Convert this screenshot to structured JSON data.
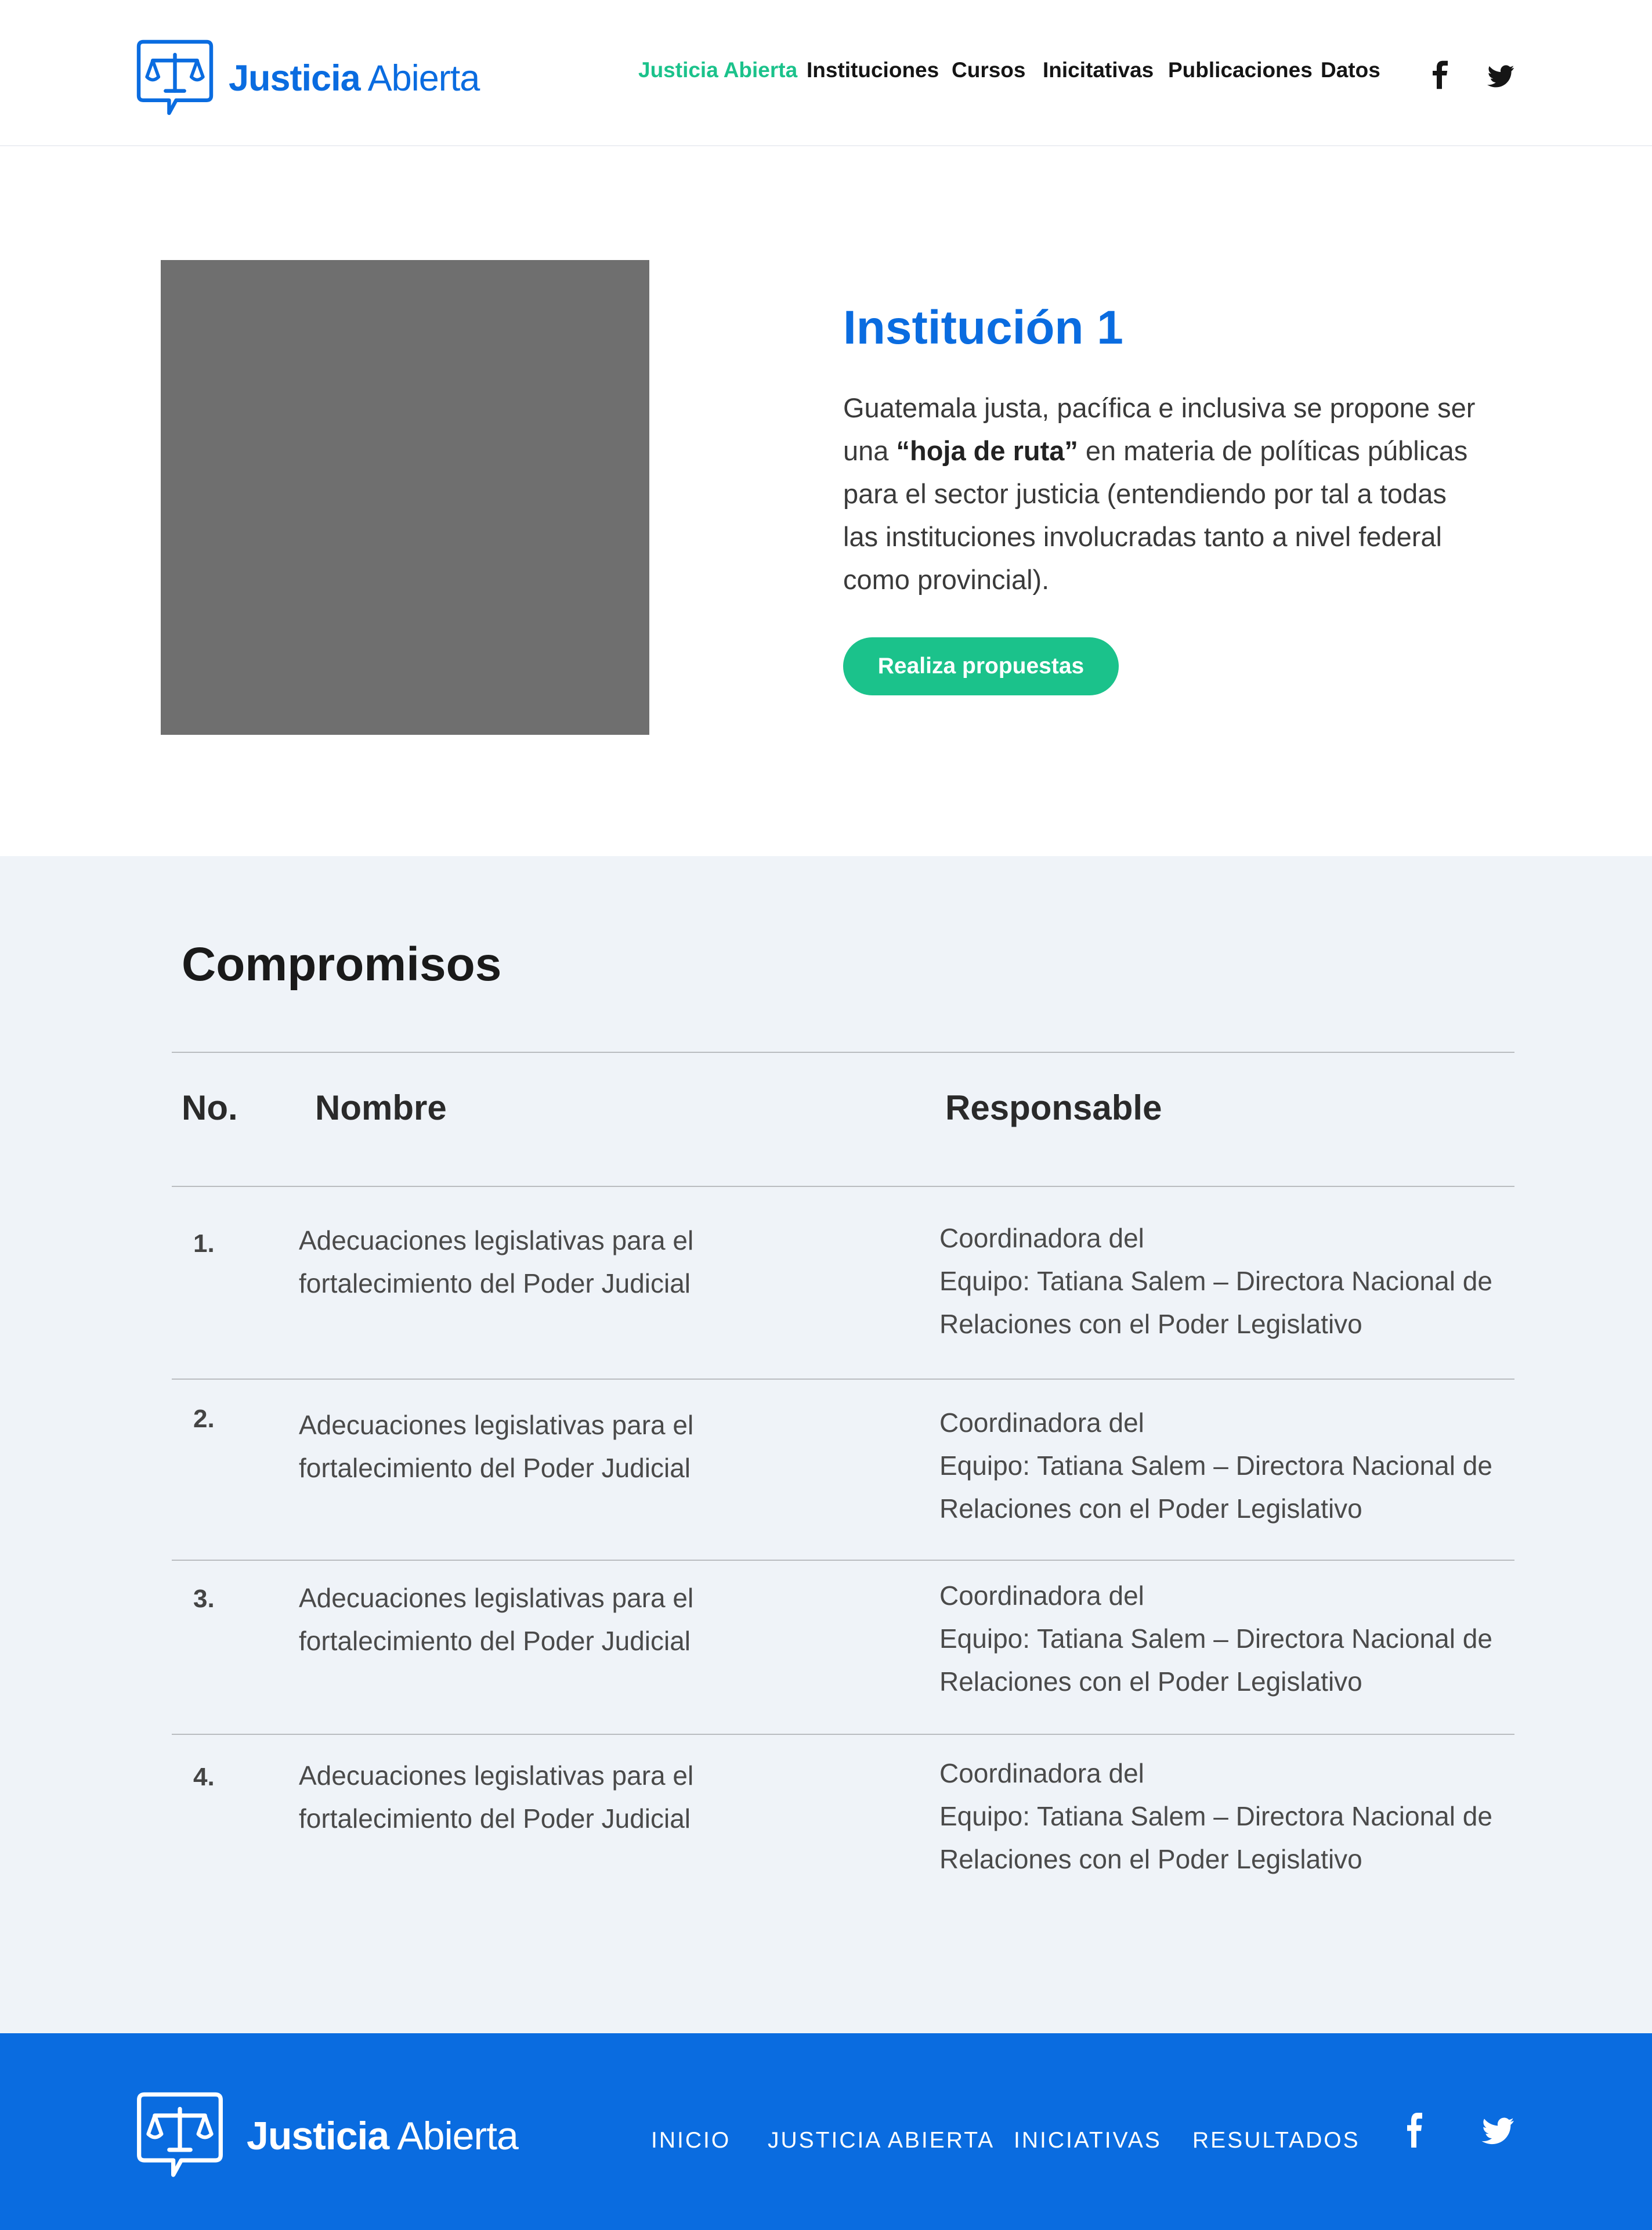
{
  "brand": {
    "name_bold": "Justicia",
    "name_light": "Abierta"
  },
  "header": {
    "nav": [
      {
        "label": "Justicia Abierta",
        "active": true
      },
      {
        "label": "Instituciones",
        "active": false
      },
      {
        "label": "Cursos",
        "active": false
      },
      {
        "label": "Inicitativas",
        "active": false
      },
      {
        "label": "Publicaciones",
        "active": false
      },
      {
        "label": "Datos",
        "active": false
      }
    ],
    "social": [
      "facebook-icon",
      "twitter-icon"
    ]
  },
  "hero": {
    "title": "Institución 1",
    "desc_before": "Guatemala justa, pacífica e inclusiva se propone ser una ",
    "desc_bold": "“hoja de ruta”",
    "desc_after": " en materia de políticas públicas para el sector justicia (entendiendo por tal a todas las instituciones involucradas tanto a nivel federal como provincial).",
    "cta_label": "Realiza propuestas"
  },
  "compromisos": {
    "title": "Compromisos",
    "headers": {
      "no": "No.",
      "name": "Nombre",
      "responsible": "Responsable"
    },
    "rows": [
      {
        "no": "1.",
        "name": "Adecuaciones legislativas para el fortalecimiento del Poder Judicial",
        "responsible_line1": "Coordinadora del",
        "responsible_line2": "Equipo: Tatiana Salem – Directora Nacional de Relaciones con el Poder Legislativo"
      },
      {
        "no": "2.",
        "name": "Adecuaciones legislativas para el fortalecimiento del Poder Judicial",
        "responsible_line1": "Coordinadora del",
        "responsible_line2": "Equipo: Tatiana Salem – Directora Nacional de Relaciones con el Poder Legislativo"
      },
      {
        "no": "3.",
        "name": "Adecuaciones legislativas para el fortalecimiento del Poder Judicial",
        "responsible_line1": "Coordinadora del",
        "responsible_line2": "Equipo: Tatiana Salem – Directora Nacional de Relaciones con el Poder Legislativo"
      },
      {
        "no": "4.",
        "name": "Adecuaciones legislativas para el fortalecimiento del Poder Judicial",
        "responsible_line1": "Coordinadora del",
        "responsible_line2": "Equipo: Tatiana Salem – Directora Nacional de Relaciones con el Poder Legislativo"
      }
    ]
  },
  "footer": {
    "nav": [
      "INICIO",
      "JUSTICIA ABIERTA",
      "INICIATIVAS",
      "RESULTADOS"
    ],
    "social": [
      "facebook-icon",
      "twitter-icon"
    ]
  },
  "colors": {
    "brand_blue": "#0a6ce0",
    "accent_green": "#1bc28b",
    "section_bg": "#eff3f8",
    "placeholder_gray": "#6f6f6f"
  }
}
